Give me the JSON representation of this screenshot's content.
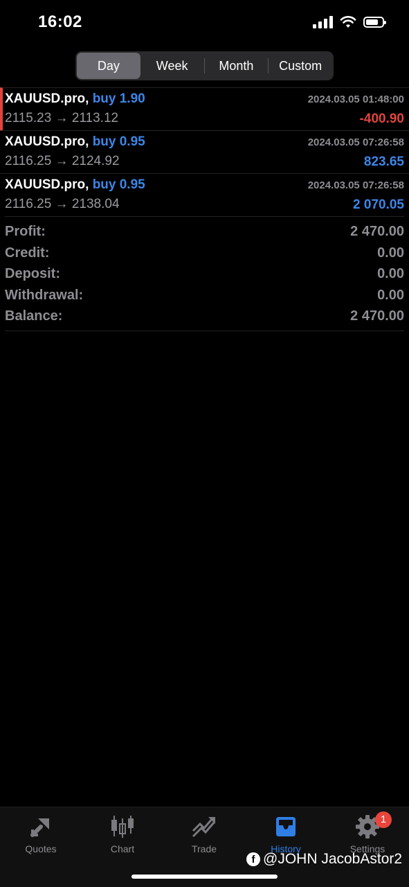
{
  "status_bar": {
    "time": "16:02"
  },
  "period_tabs": [
    {
      "label": "Day",
      "active": true
    },
    {
      "label": "Week",
      "active": false
    },
    {
      "label": "Month",
      "active": false
    },
    {
      "label": "Custom",
      "active": false
    }
  ],
  "deals": [
    {
      "symbol": "XAUUSD.pro,",
      "direction": "buy 1.90",
      "time": "2024.03.05 01:48:00",
      "prices": "2115.23 → 2113.12",
      "profit": "-400.90",
      "profit_sign": "negative"
    },
    {
      "symbol": "XAUUSD.pro,",
      "direction": "buy 0.95",
      "time": "2024.03.05 07:26:58",
      "prices": "2116.25 → 2124.92",
      "profit": "823.65",
      "profit_sign": "positive"
    },
    {
      "symbol": "XAUUSD.pro,",
      "direction": "buy 0.95",
      "time": "2024.03.05 07:26:58",
      "prices": "2116.25 → 2138.04",
      "profit": "2 070.05",
      "profit_sign": "positive"
    }
  ],
  "summary": [
    {
      "label": "Profit:",
      "value": "2 470.00"
    },
    {
      "label": "Credit:",
      "value": "0.00"
    },
    {
      "label": "Deposit:",
      "value": "0.00"
    },
    {
      "label": "Withdrawal:",
      "value": "0.00"
    },
    {
      "label": "Balance:",
      "value": "2 470.00"
    }
  ],
  "tab_bar": {
    "tabs": [
      {
        "label": "Quotes",
        "icon": "quotes-icon",
        "active": false
      },
      {
        "label": "Chart",
        "icon": "chart-icon",
        "active": false
      },
      {
        "label": "Trade",
        "icon": "trade-icon",
        "active": false
      },
      {
        "label": "History",
        "icon": "history-icon",
        "active": true
      },
      {
        "label": "Settings",
        "icon": "gear-icon",
        "active": false,
        "badge": "1"
      }
    ]
  },
  "watermark": {
    "text": "@JOHN JacobAstor2",
    "logo_letter": "f"
  },
  "colors": {
    "accent": "#2f7ee6",
    "negative": "#e0443d",
    "positive": "#3d86e8",
    "muted": "#8e8e93"
  }
}
